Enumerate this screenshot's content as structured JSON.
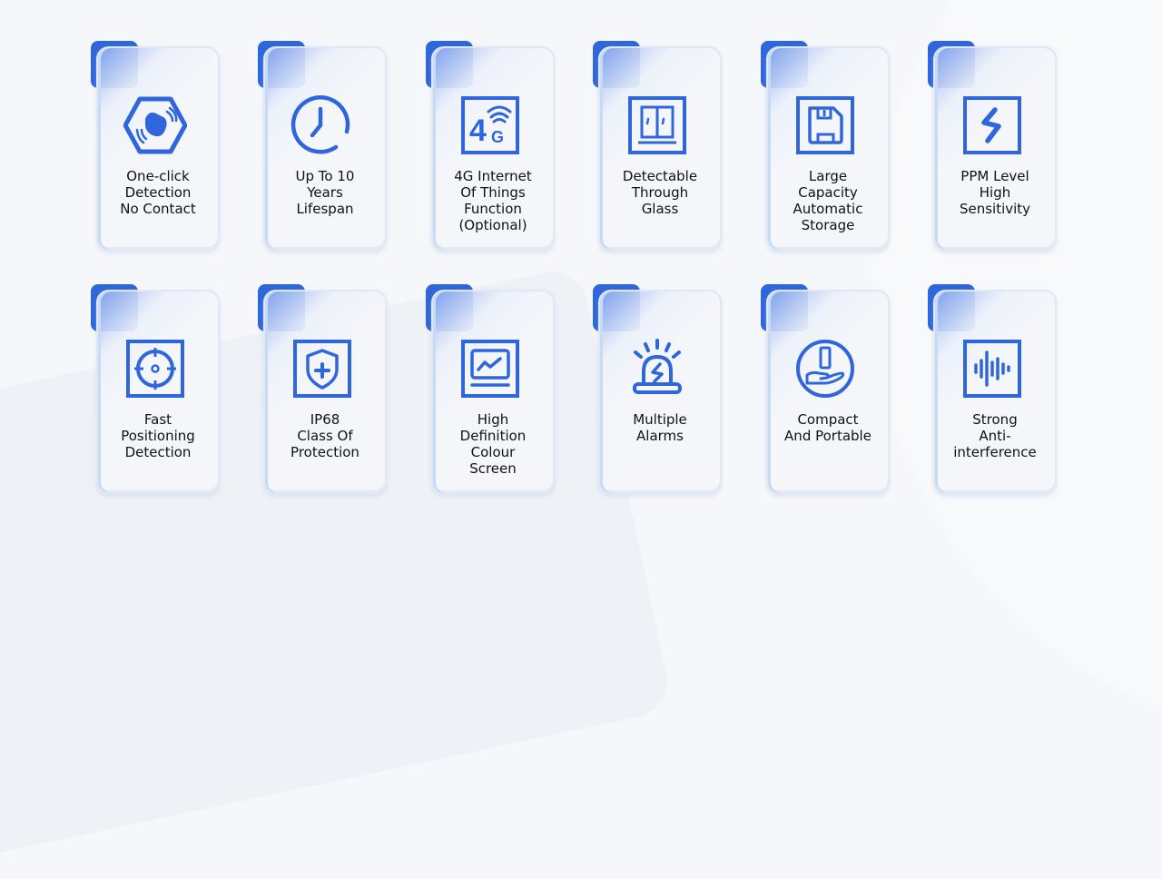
{
  "accent_color": "#2f66dc",
  "features": [
    {
      "label": "One-click\nDetection\nNo Contact",
      "icon": "hand-wave-hexagon-icon"
    },
    {
      "label": "Up To 10\nYears\nLifespan",
      "icon": "clock-icon"
    },
    {
      "label": "4G Internet\nOf Things\nFunction\n(Optional)",
      "icon": "4g-signal-icon"
    },
    {
      "label": "Detectable\nThrough\nGlass",
      "icon": "window-glass-icon"
    },
    {
      "label": "Large\nCapacity\nAutomatic\nStorage",
      "icon": "floppy-disk-icon"
    },
    {
      "label": "PPM Level\nHigh\nSensitivity",
      "icon": "lightning-icon"
    },
    {
      "label": "Fast\nPositioning\nDetection",
      "icon": "crosshair-icon"
    },
    {
      "label": "IP68\nClass Of\nProtection",
      "icon": "shield-plus-icon"
    },
    {
      "label": "High\nDefinition\nColour\nScreen",
      "icon": "monitor-chart-icon"
    },
    {
      "label": "Multiple\nAlarms",
      "icon": "alarm-siren-icon"
    },
    {
      "label": "Compact\nAnd Portable",
      "icon": "hand-device-icon"
    },
    {
      "label": "Strong\nAnti-\ninterference",
      "icon": "sound-wave-icon"
    }
  ]
}
